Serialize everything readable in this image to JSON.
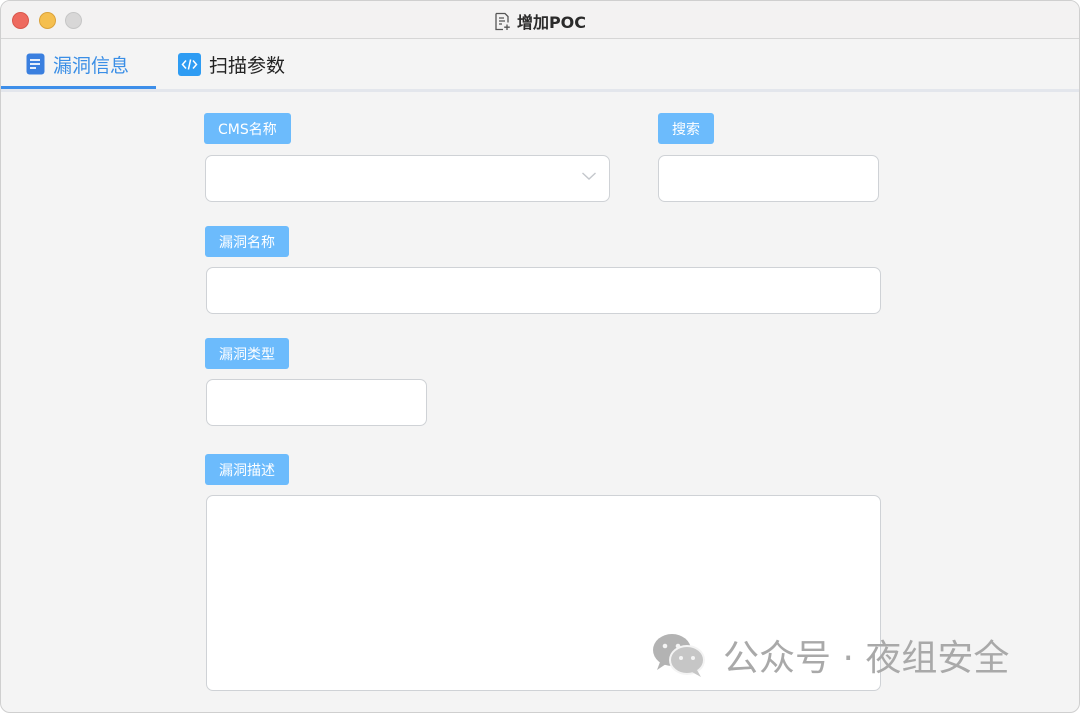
{
  "window": {
    "title": "增加POC"
  },
  "tabs": [
    {
      "label": "漏洞信息",
      "active": true,
      "icon": "document-icon"
    },
    {
      "label": "扫描参数",
      "active": false,
      "icon": "code-icon"
    }
  ],
  "form": {
    "cms_label": "CMS名称",
    "cms_value": "",
    "search_label": "搜索",
    "search_value": "",
    "vuln_name_label": "漏洞名称",
    "vuln_name_value": "",
    "vuln_type_label": "漏洞类型",
    "vuln_type_value": "",
    "vuln_desc_label": "漏洞描述",
    "vuln_desc_value": ""
  },
  "watermark": {
    "text": "公众号 · 夜组安全",
    "icon": "wechat-icon"
  },
  "colors": {
    "accent": "#3a8ee6",
    "tag_bg": "#6cbbfc",
    "code_icon_bg": "#2e9cf3"
  }
}
